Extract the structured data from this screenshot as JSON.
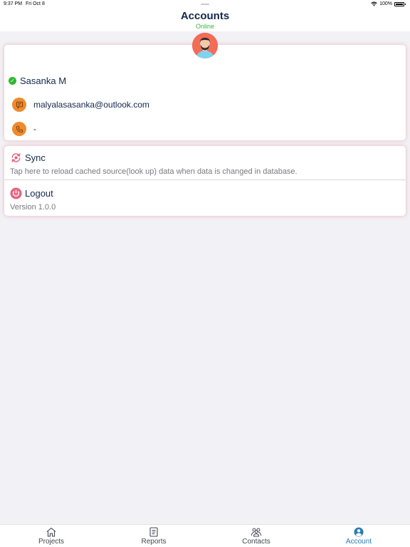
{
  "status": {
    "time": "9:37 PM",
    "date": "Fri Oct 8",
    "battery": "100%"
  },
  "header": {
    "title": "Accounts",
    "subtitle": "Online"
  },
  "profile": {
    "name": "Sasanka M",
    "email": "malyalasasanka@outlook.com",
    "phone": "-"
  },
  "actions": {
    "sync": {
      "label": "Sync",
      "description": "Tap here to reload cached source(look up) data when data is changed in database."
    },
    "logout": {
      "label": "Logout",
      "description": "Version 1.0.0"
    }
  },
  "tabs": [
    {
      "label": "Projects",
      "icon": "home-icon"
    },
    {
      "label": "Reports",
      "icon": "document-icon"
    },
    {
      "label": "Contacts",
      "icon": "people-icon"
    },
    {
      "label": "Account",
      "icon": "account-icon",
      "active": true
    }
  ],
  "colors": {
    "accent": "#2a7bb4",
    "online": "#3cb43c",
    "avatar": "#f26c58",
    "icon_orange": "#f08a2c",
    "logout_pink": "#e8637f",
    "title": "#14284b"
  }
}
